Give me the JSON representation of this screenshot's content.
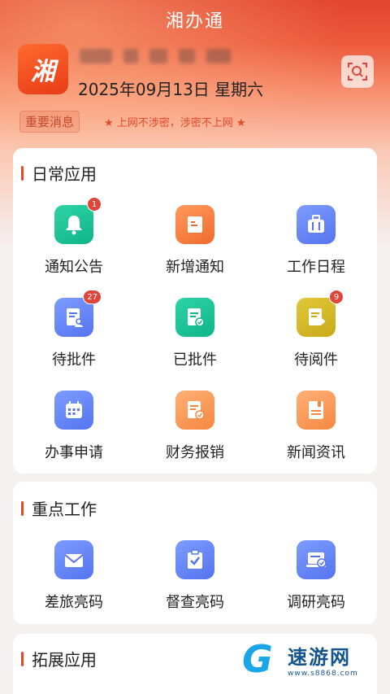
{
  "header": {
    "app_title": "湘办通",
    "logo_text": "湘",
    "date": "2025年09月13日 星期六",
    "notice_tag": "重要消息",
    "notice_text": "★ 上网不涉密，涉密不上网 ★"
  },
  "sections": {
    "daily": {
      "title": "日常应用",
      "items": [
        {
          "label": "通知公告",
          "icon": "bell-icon",
          "badge": "1"
        },
        {
          "label": "新增通知",
          "icon": "book-icon"
        },
        {
          "label": "工作日程",
          "icon": "briefcase-icon"
        },
        {
          "label": "待批件",
          "icon": "doc-user-icon",
          "badge": "27"
        },
        {
          "label": "已批件",
          "icon": "doc-check-icon"
        },
        {
          "label": "待阅件",
          "icon": "doc-arrow-icon",
          "badge": "9"
        },
        {
          "label": "办事申请",
          "icon": "calendar-icon"
        },
        {
          "label": "财务报销",
          "icon": "receipt-icon"
        },
        {
          "label": "新闻资讯",
          "icon": "news-icon"
        }
      ]
    },
    "key_work": {
      "title": "重点工作",
      "items": [
        {
          "label": "差旅亮码",
          "icon": "envelope-icon"
        },
        {
          "label": "督查亮码",
          "icon": "clipboard-check-icon"
        },
        {
          "label": "调研亮码",
          "icon": "laptop-check-icon"
        }
      ]
    },
    "extended": {
      "title": "拓展应用"
    }
  },
  "watermark": {
    "brand": "速游网",
    "url": "www.s8868.com"
  },
  "colors": {
    "accent": "#e24a2a",
    "badge": "#e0453a"
  }
}
